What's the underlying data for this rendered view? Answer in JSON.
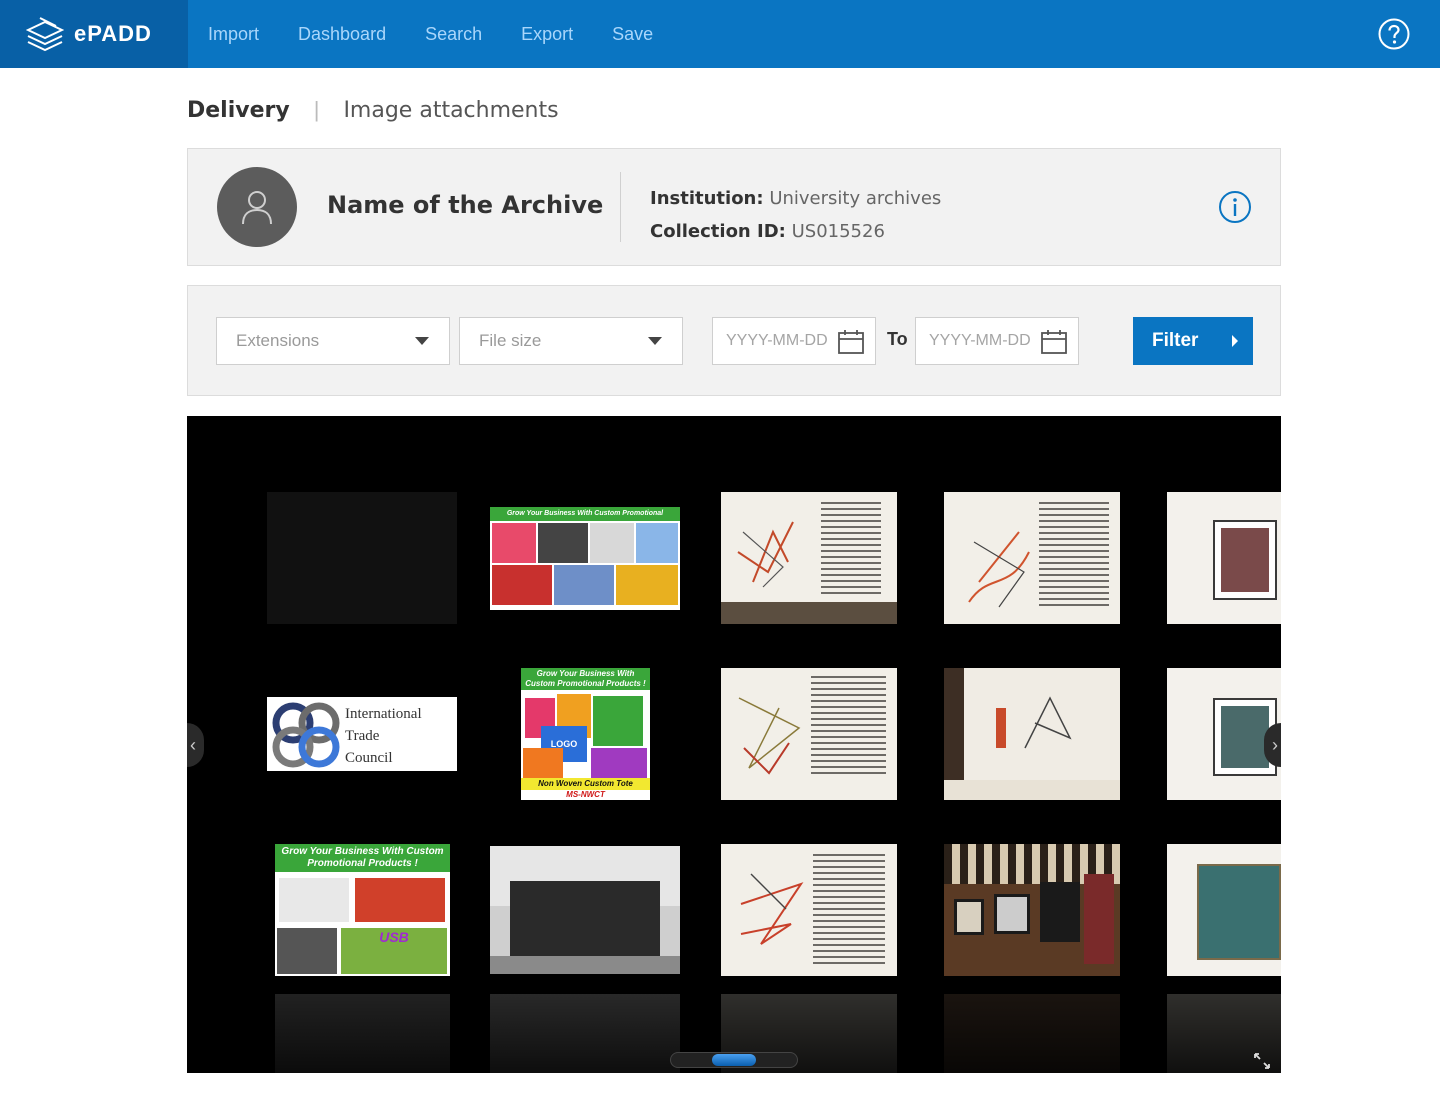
{
  "app": {
    "logo_text": "ePADD",
    "nav": [
      "Import",
      "Dashboard",
      "Search",
      "Export",
      "Save"
    ]
  },
  "breadcrumb": {
    "first": "Delivery",
    "separator": "|",
    "second": "Image attachments"
  },
  "archive": {
    "name": "Name of the Archive",
    "institution_label": "Institution:",
    "institution_value": "University archives",
    "collection_label": "Collection ID:",
    "collection_value": "US015526"
  },
  "filters": {
    "extensions_placeholder": "Extensions",
    "filesize_placeholder": "File size",
    "date_from_placeholder": "YYYY-MM-DD",
    "to_label": "To",
    "date_to_placeholder": "YYYY-MM-DD",
    "filter_button": "Filter"
  },
  "gallery": {
    "itc_logo_lines": [
      "International",
      "Trade",
      "Council"
    ],
    "promo_banner_1": "Grow Your Business With Custom Promotional Products!",
    "promo_banner_2": "Grow Your Business With Custom Promotional Products !",
    "promo_banner_3": "Grow Your Business With Custom Promotional Products !",
    "tote_caption": "Non Woven Custom Tote",
    "tote_code": "MS-NWCT",
    "logo_tag": "LOGO",
    "usb_tag": "USB"
  }
}
